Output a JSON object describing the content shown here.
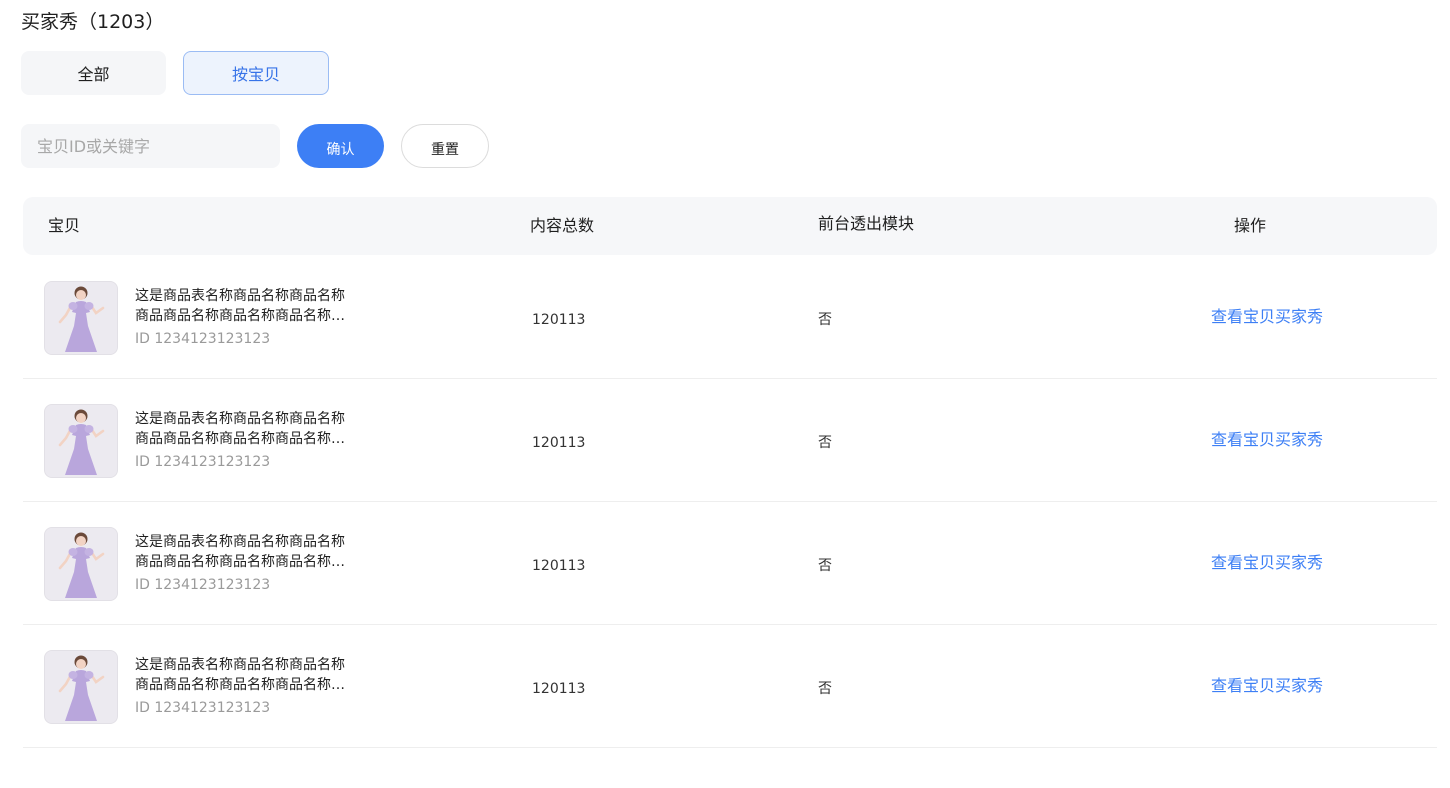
{
  "header": {
    "title": "买家秀（1203）"
  },
  "tabs": [
    {
      "label": "全部",
      "active": false
    },
    {
      "label": "按宝贝",
      "active": true
    }
  ],
  "filter": {
    "search_placeholder": "宝贝ID或关键字",
    "search_value": "",
    "confirm_label": "确认",
    "reset_label": "重置"
  },
  "table": {
    "columns": [
      "宝贝",
      "内容总数",
      "前台透出模块",
      "操作"
    ],
    "rows": [
      {
        "name": "这是商品表名称商品名称商品名称商品商品名称商品名称商品名称商品名称",
        "id_text": "ID 1234123123123",
        "thumbnail_icon": "dress-model-photo",
        "count": "120113",
        "module": "否",
        "action": "查看宝贝买家秀"
      },
      {
        "name": "这是商品表名称商品名称商品名称商品商品名称商品名称商品名称商品名称",
        "id_text": "ID 1234123123123",
        "thumbnail_icon": "dress-model-photo",
        "count": "120113",
        "module": "否",
        "action": "查看宝贝买家秀"
      },
      {
        "name": "这是商品表名称商品名称商品名称商品商品名称商品名称商品名称商品名称",
        "id_text": "ID 1234123123123",
        "thumbnail_icon": "dress-model-photo",
        "count": "120113",
        "module": "否",
        "action": "查看宝贝买家秀"
      },
      {
        "name": "这是商品表名称商品名称商品名称商品商品名称商品名称商品名称商品名称",
        "id_text": "ID 1234123123123",
        "thumbnail_icon": "dress-model-photo",
        "count": "120113",
        "module": "否",
        "action": "查看宝贝买家秀"
      }
    ]
  },
  "colors": {
    "accent": "#3d7ff5",
    "active_tab_bg": "#edf3fd",
    "active_tab_border": "#9bbcf4",
    "muted_bg": "#f5f6f8",
    "dress": "#b9a6dc"
  }
}
